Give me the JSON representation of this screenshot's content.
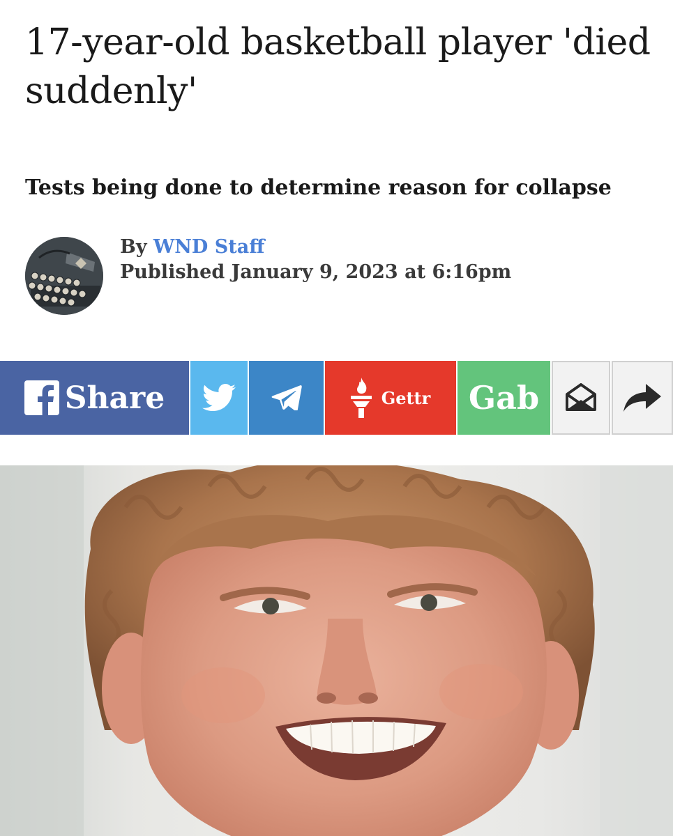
{
  "article": {
    "headline": "17-year-old basketball player 'died suddenly'",
    "subheadline": "Tests being done to determine reason for collapse",
    "byline_prefix": "By",
    "author": "WND Staff",
    "published": "Published January 9, 2023 at 6:16pm"
  },
  "share_bar": {
    "facebook": {
      "label": "Share",
      "icon": "facebook-icon",
      "color": "#4a64a3"
    },
    "twitter": {
      "icon": "twitter-bird-icon",
      "color": "#5ab8ee"
    },
    "telegram": {
      "icon": "telegram-plane-icon",
      "color": "#3c86c7"
    },
    "gettr": {
      "label": "Gettr",
      "icon": "gettr-torch-icon",
      "color": "#e5392b"
    },
    "gab": {
      "label": "Gab",
      "color": "#63c47c"
    },
    "email": {
      "icon": "envelope-icon"
    },
    "forward": {
      "icon": "share-arrow-icon"
    }
  },
  "author_link_color": "#4a7fd6"
}
